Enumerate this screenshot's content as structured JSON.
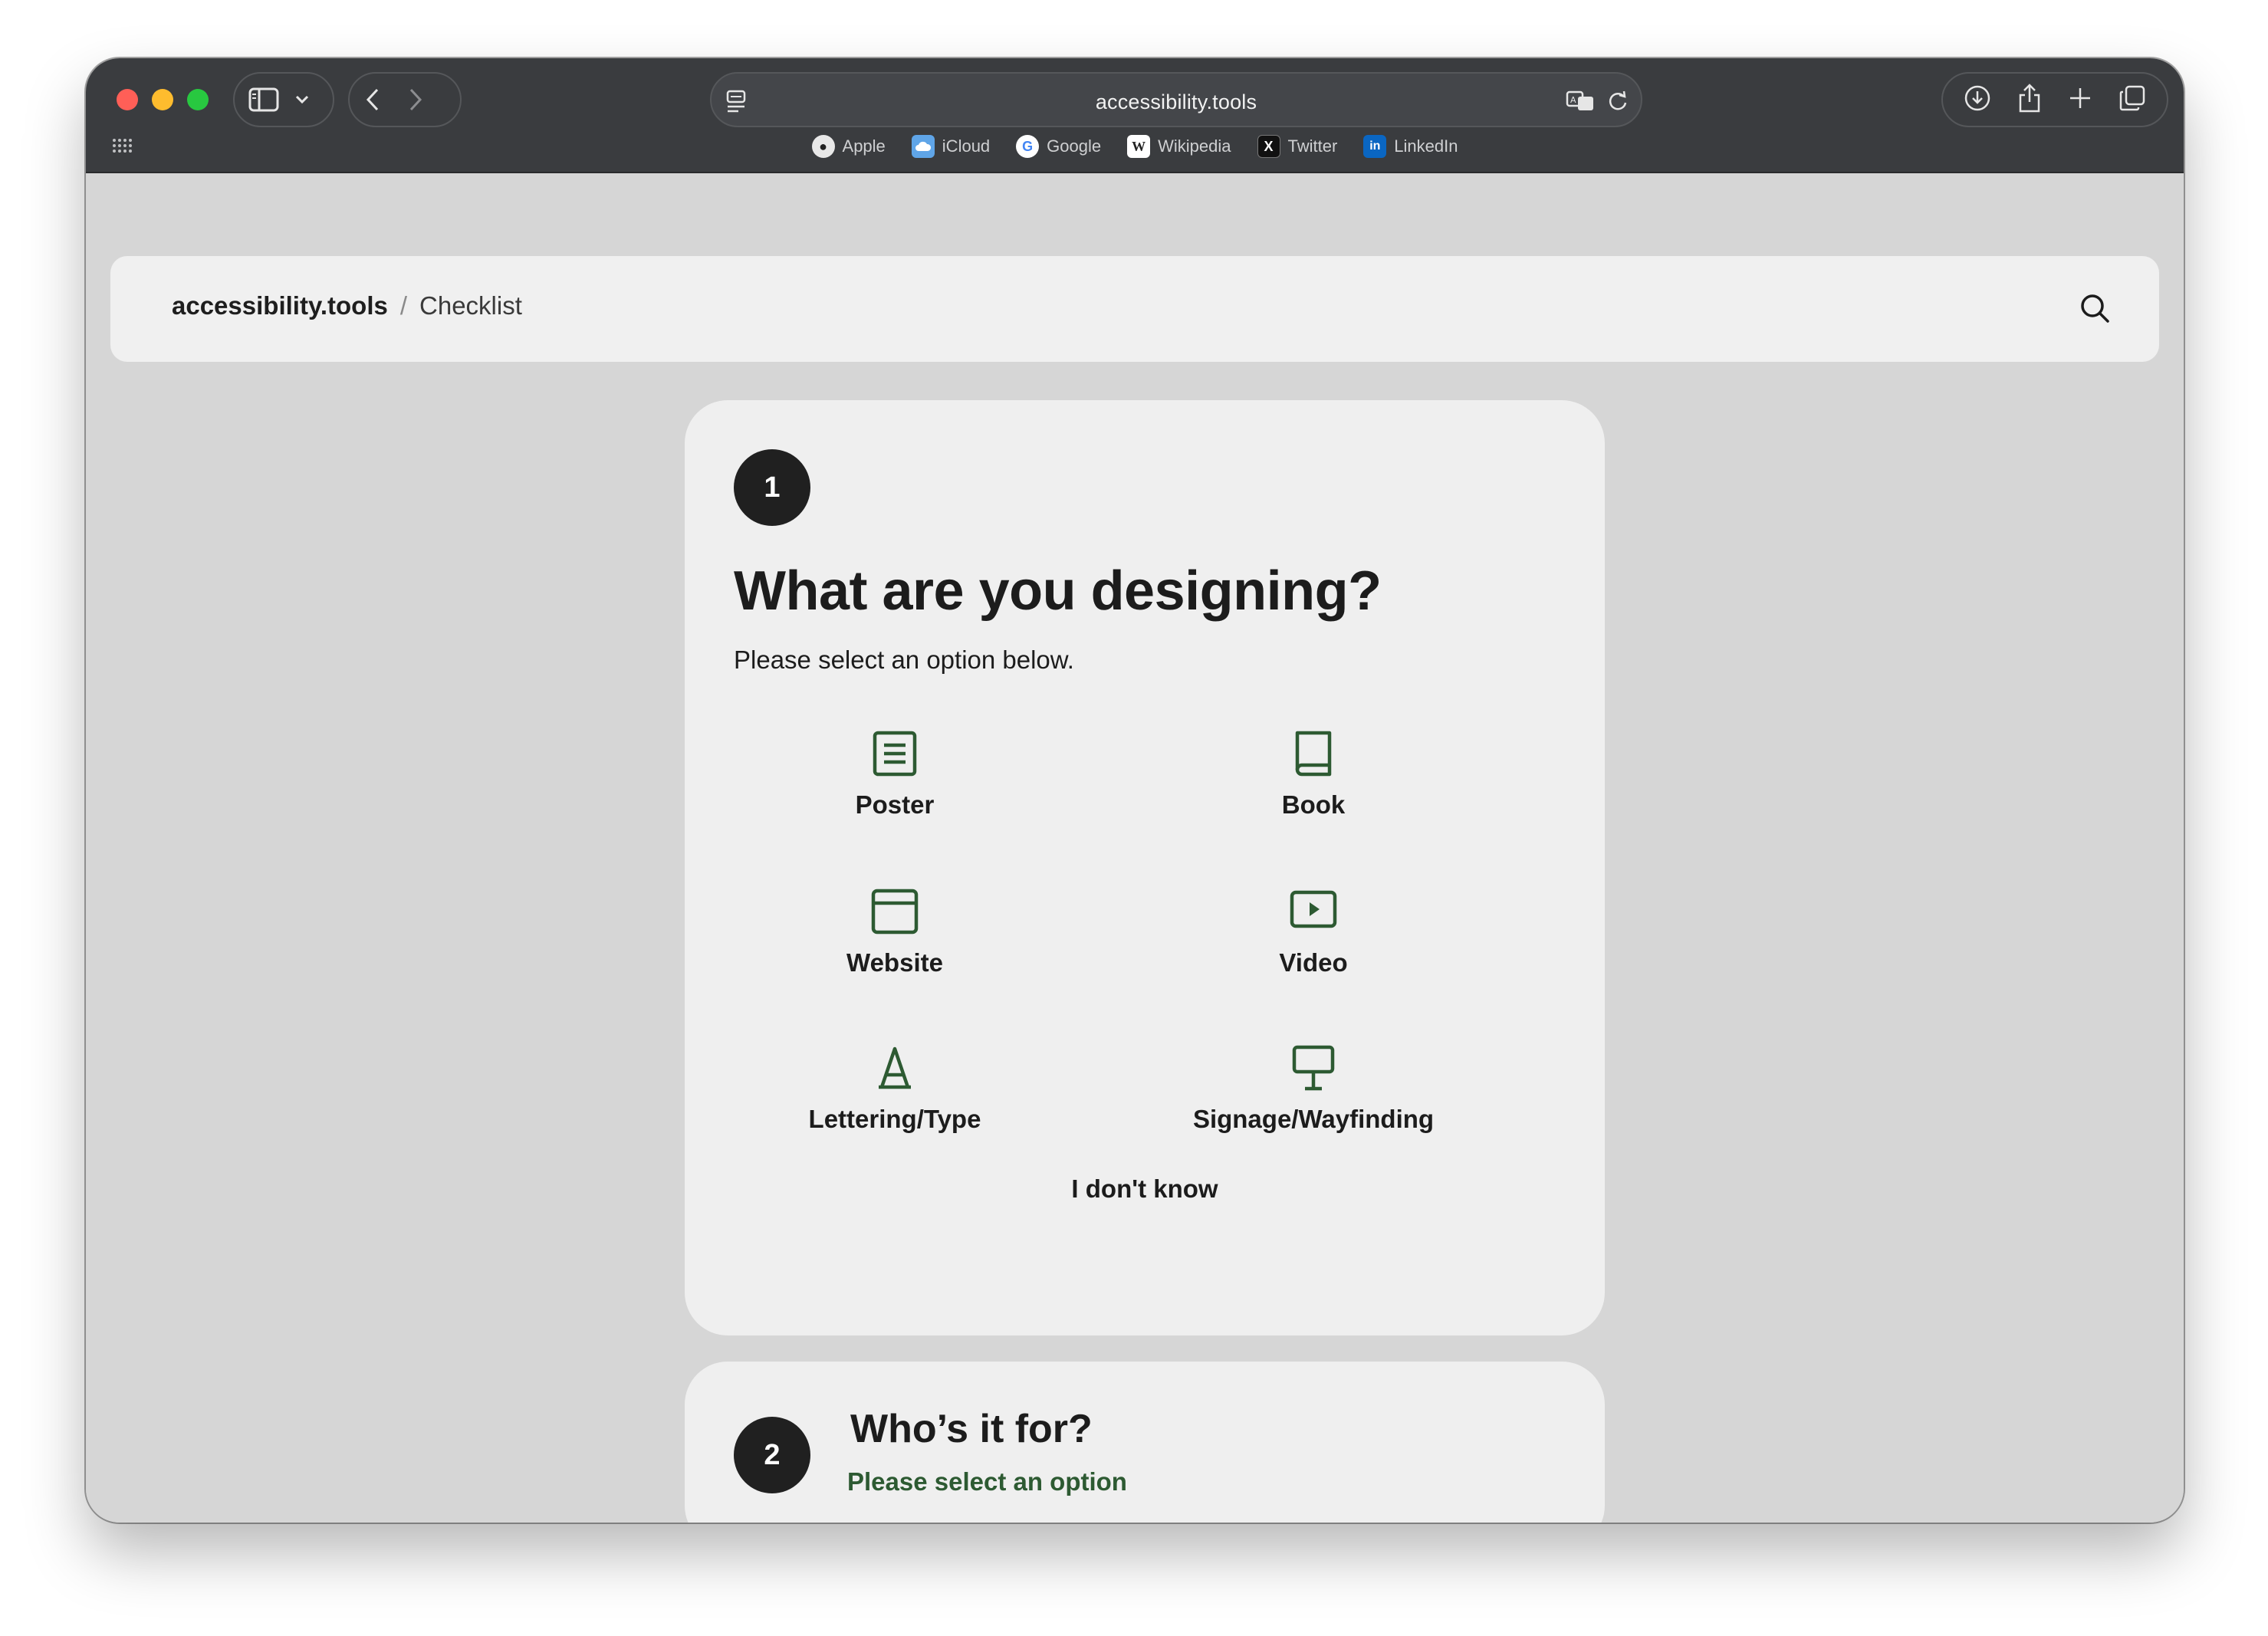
{
  "browser": {
    "url": "accessibility.tools",
    "favorites": [
      {
        "label": "Apple",
        "icon": "apple-icon"
      },
      {
        "label": "iCloud",
        "icon": "icloud-icon"
      },
      {
        "label": "Google",
        "icon": "google-icon"
      },
      {
        "label": "Wikipedia",
        "icon": "wikipedia-icon"
      },
      {
        "label": "Twitter",
        "icon": "twitter-x-icon"
      },
      {
        "label": "LinkedIn",
        "icon": "linkedin-icon"
      }
    ]
  },
  "header": {
    "site": "accessibility.tools",
    "separator": "/",
    "current": "Checklist"
  },
  "step1": {
    "number": "1",
    "title": "What are you designing?",
    "subtitle": "Please select an option below.",
    "options": [
      {
        "label": "Poster",
        "icon": "poster-icon"
      },
      {
        "label": "Book",
        "icon": "book-icon"
      },
      {
        "label": "Website",
        "icon": "website-icon"
      },
      {
        "label": "Video",
        "icon": "video-icon"
      },
      {
        "label": "Lettering/Type",
        "icon": "lettering-icon"
      },
      {
        "label": "Signage/Wayfinding",
        "icon": "signage-icon"
      }
    ],
    "unknown_label": "I don't know"
  },
  "step2": {
    "number": "2",
    "title": "Who’s it for?",
    "subtitle": "Please select an option"
  },
  "colors": {
    "accent_green": "#2d5a32",
    "titlebar": "#3a3c3f",
    "page_bg": "#d6d6d6",
    "card_bg": "#efefef"
  }
}
